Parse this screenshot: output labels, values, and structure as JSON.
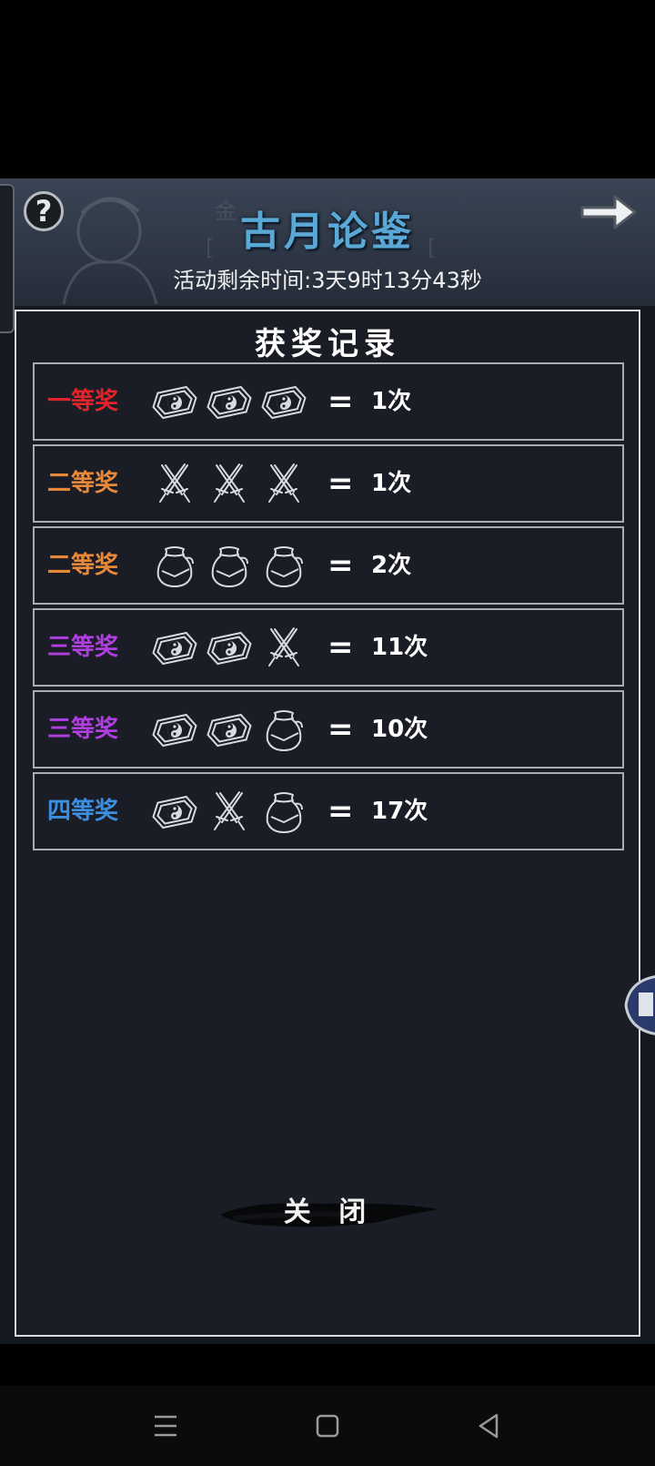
{
  "header": {
    "title": "古月论鉴",
    "timer_label": "活动剩余时间:",
    "timer_value": "3天9时13分43秒",
    "help_glyph": "?",
    "title_color": "#5aa8d6"
  },
  "panel": {
    "title": "获奖记录",
    "close_label": "关 闭"
  },
  "records": [
    {
      "name": "一等奖",
      "color": "#e0242a",
      "icons": [
        "taiji-coin-icon",
        "taiji-coin-icon",
        "taiji-coin-icon"
      ],
      "count": "1次"
    },
    {
      "name": "二等奖",
      "color": "#e8893a",
      "icons": [
        "crossed-swords-icon",
        "crossed-swords-icon",
        "crossed-swords-icon"
      ],
      "count": "1次"
    },
    {
      "name": "二等奖",
      "color": "#e8893a",
      "icons": [
        "pouch-icon",
        "pouch-icon",
        "pouch-icon"
      ],
      "count": "2次"
    },
    {
      "name": "三等奖",
      "color": "#b03ee0",
      "icons": [
        "taiji-coin-icon",
        "taiji-coin-icon",
        "crossed-swords-icon"
      ],
      "count": "11次"
    },
    {
      "name": "三等奖",
      "color": "#b03ee0",
      "icons": [
        "taiji-coin-icon",
        "taiji-coin-icon",
        "pouch-icon"
      ],
      "count": "10次"
    },
    {
      "name": "四等奖",
      "color": "#3c8fe0",
      "icons": [
        "taiji-coin-icon",
        "crossed-swords-icon",
        "pouch-icon"
      ],
      "count": "17次"
    }
  ],
  "equals": "=",
  "nav": [
    "menu-icon",
    "home-square-icon",
    "back-triangle-icon"
  ]
}
